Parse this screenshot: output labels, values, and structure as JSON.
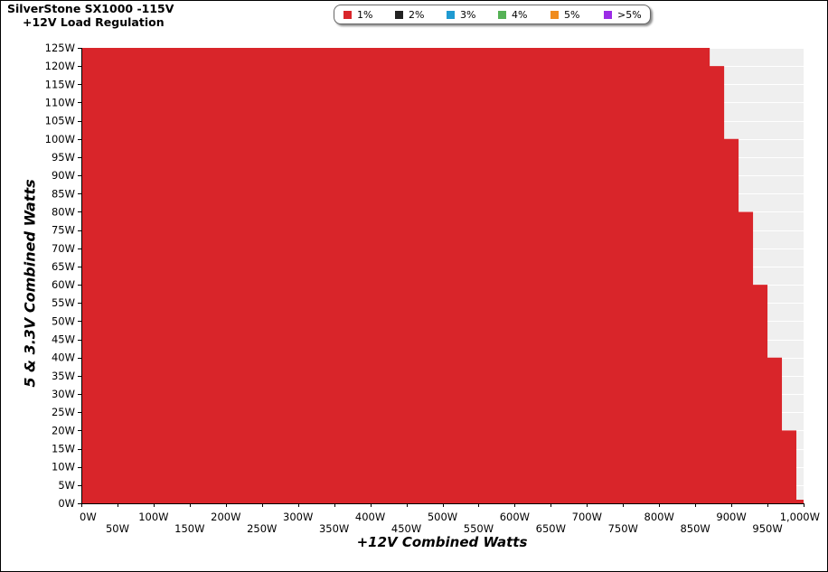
{
  "title": {
    "line1": "SilverStone  SX1000 -115V",
    "line2": "+12V Load Regulation"
  },
  "legend": [
    {
      "label": "1%",
      "color": "#d9252a"
    },
    {
      "label": "2%",
      "color": "#222222"
    },
    {
      "label": "3%",
      "color": "#1f9ad1"
    },
    {
      "label": "4%",
      "color": "#55b155"
    },
    {
      "label": "5%",
      "color": "#f08c1e"
    },
    {
      "label": ">5%",
      "color": "#9b2be6"
    }
  ],
  "chart_data": {
    "type": "area",
    "title": "SilverStone  SX1000 -115V\n+12V Load Regulation",
    "xlabel": "+12V Combined Watts",
    "ylabel": "5 & 3.3V Combined Watts",
    "xlim": [
      0,
      1000
    ],
    "ylim": [
      0,
      125
    ],
    "x_ticks": [
      "0W",
      "50W",
      "100W",
      "150W",
      "200W",
      "250W",
      "300W",
      "350W",
      "400W",
      "450W",
      "500W",
      "550W",
      "600W",
      "650W",
      "700W",
      "750W",
      "800W",
      "850W",
      "900W",
      "950W",
      "1,000W"
    ],
    "y_ticks": [
      "0W",
      "5W",
      "10W",
      "15W",
      "20W",
      "25W",
      "30W",
      "35W",
      "40W",
      "45W",
      "50W",
      "55W",
      "60W",
      "65W",
      "70W",
      "75W",
      "80W",
      "85W",
      "90W",
      "95W",
      "100W",
      "105W",
      "110W",
      "115W",
      "120W",
      "125W"
    ],
    "grid": true,
    "legend_position": "top-center",
    "region": {
      "category": "1%",
      "color": "#d9252a",
      "boundary": [
        {
          "max_12v": 870,
          "min_5v33v": 120
        },
        {
          "max_12v": 890,
          "min_5v33v": 100
        },
        {
          "max_12v": 910,
          "min_5v33v": 80
        },
        {
          "max_12v": 930,
          "min_5v33v": 60
        },
        {
          "max_12v": 950,
          "min_5v33v": 40
        },
        {
          "max_12v": 970,
          "min_5v33v": 20
        },
        {
          "max_12v": 990,
          "min_5v33v": 1
        },
        {
          "max_12v": 1010,
          "min_5v33v": 0
        }
      ]
    }
  }
}
